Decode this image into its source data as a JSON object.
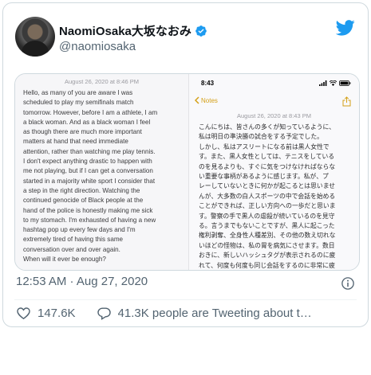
{
  "tweet": {
    "display_name": "NaomiOsaka大坂なおみ",
    "handle": "@naomiosaka",
    "timestamp": "12:53 AM · Aug 27, 2020",
    "likes": "147.6K",
    "tweeting_about": "41.3K people are Tweeting about t…"
  },
  "media": {
    "left": {
      "date_stamp": "August 26, 2020 at 8:46 PM",
      "body": "Hello, as many of you are aware I was\nscheduled to play my semifinals match\ntomorrow. However, before I am a athlete, I am\na black woman. And as a black woman I feel\nas though there are much more important\nmatters at hand that need immediate\nattention, rather than watching me play tennis.\nI don't expect anything drastic to happen with\nme not playing, but if I can get a conversation\nstarted in a majority white sport I consider that\na step in the right direction. Watching the\ncontinued genocide of Black people at the\nhand of the police is honestly making me sick\nto my stomach. I'm exhausted of having a new\nhashtag pop up every few days and I'm\nextremely tired of having this same\nconversation over and over again.\nWhen will it ever be enough?"
    },
    "right": {
      "status_time": "8:43",
      "back_label": "Notes",
      "date_stamp": "August 26, 2020 at 8:43 PM",
      "body": "こんにちは、皆さんの多くが知っているように、\n私は明日の準決勝の試合をする予定でした。\nしかし、私はアスリートになる前は黒人女性で\nす。また、黒人女性としては、テニスをしている\nのを見るよりも、すぐに気をつけなければならな\nい重要な事柄があるように感じます。私が、プ\nレーしていないときに何かが起こるとは思いませ\nんが、大多数の白人スポーツの中で会話を始める\nことができれば、正しい方向への一歩だと思いま\nす。警察の手で黒人の虐殺が続いているのを見守\nる。言うまでもないことですが、黒人に起こった\n権利剥奪、全身性人種差別、その他の数え切れな\nいほどの怪物は、私の胃を病気にさせます。数日\nおきに、新しいハッシュタグが表示されるのに疲\nれて、何度も何度も同じ会話をするのに非常に疲"
    }
  },
  "icons": {
    "verified": "verified-badge-icon",
    "brand": "twitter-bird-icon",
    "info": "info-icon",
    "like": "heart-icon",
    "reply": "reply-bubble-icon"
  },
  "colors": {
    "brand_blue": "#1d9bf0",
    "notes_gold": "#d4a017",
    "secondary_text": "#536471"
  }
}
